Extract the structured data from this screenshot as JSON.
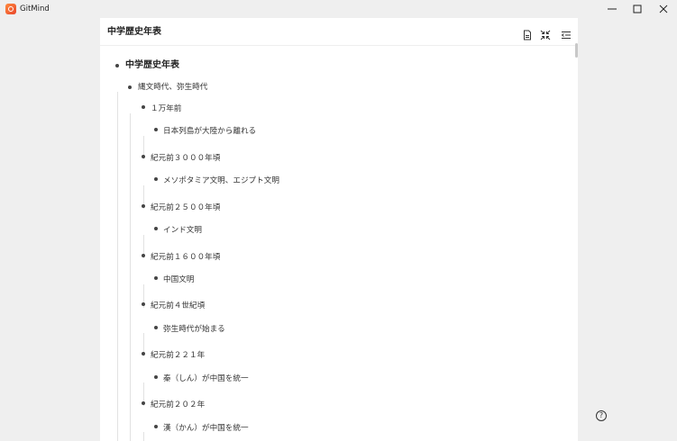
{
  "app": {
    "title": "GitMind"
  },
  "document": {
    "title": "中学歴史年表"
  },
  "outline": {
    "root": "中学歴史年表",
    "era": "縄文時代、弥生時代",
    "entries": [
      {
        "date": "１万年前",
        "event": "日本列島が大陸から離れる"
      },
      {
        "date": "紀元前３０００年頃",
        "event": "メソポタミア文明、エジプト文明"
      },
      {
        "date": "紀元前２５００年頃",
        "event": "インド文明"
      },
      {
        "date": "紀元前１６００年頃",
        "event": "中国文明"
      },
      {
        "date": "紀元前４世紀頃",
        "event": "弥生時代が始まる"
      },
      {
        "date": "紀元前２２１年",
        "event": "秦（しん）が中国を統一"
      },
      {
        "date": "紀元前２０２年",
        "event": "漢（かん）が中国を統一"
      }
    ]
  },
  "icons": {
    "export": "export-file-icon",
    "collapse": "collapse-arrows-icon",
    "outline": "outline-view-icon",
    "help": "help-icon"
  },
  "help": {
    "label": "?"
  }
}
